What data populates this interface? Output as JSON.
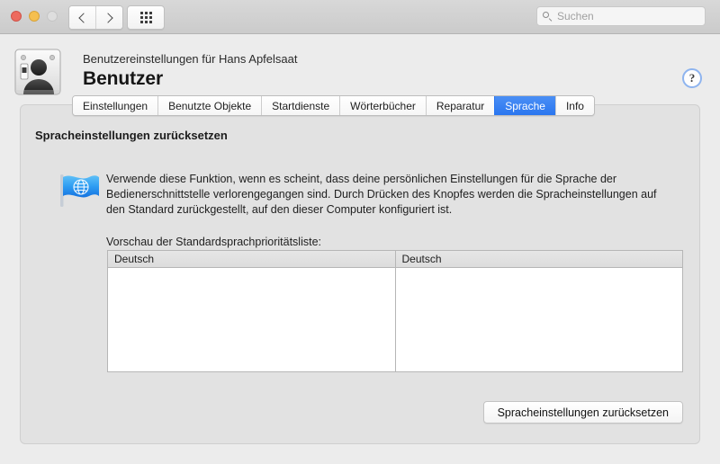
{
  "window": {
    "traffic_lights": [
      "close",
      "minimize",
      "zoom"
    ],
    "nav": {
      "back_label": "‹",
      "forward_label": "›"
    },
    "grid_button_name": "show-all"
  },
  "search": {
    "placeholder": "Suchen",
    "value": ""
  },
  "header": {
    "subtitle": "Benutzereinstellungen für Hans Apfelsaat",
    "title": "Benutzer",
    "help_label": "?"
  },
  "tabs": [
    {
      "label": "Einstellungen",
      "active": false
    },
    {
      "label": "Benutzte Objekte",
      "active": false
    },
    {
      "label": "Startdienste",
      "active": false
    },
    {
      "label": "Wörterbücher",
      "active": false
    },
    {
      "label": "Reparatur",
      "active": false
    },
    {
      "label": "Sprache",
      "active": true
    },
    {
      "label": "Info",
      "active": false
    }
  ],
  "content": {
    "section_title": "Spracheinstellungen zurücksetzen",
    "description": "Verwende diese Funktion, wenn es scheint, dass deine persönlichen Einstellungen für die Sprache der Bedienerschnittstelle verlorengegangen sind. Durch Drücken des Knopfes werden die Spracheinstellungen auf den Standard zurückgestellt, auf den dieser Computer konfiguriert ist.",
    "preview_label": "Vorschau der Standardsprachprioritätsliste:",
    "list": {
      "columns": [
        {
          "header": "Deutsch",
          "rows": []
        },
        {
          "header": "Deutsch",
          "rows": []
        }
      ]
    },
    "reset_button": "Spracheinstellungen zurücksetzen"
  },
  "colors": {
    "accent": "#2a76ef",
    "window_bg": "#ececec",
    "panel_bg": "#e2e2e2",
    "flag_blue": "#3aa0f0"
  }
}
